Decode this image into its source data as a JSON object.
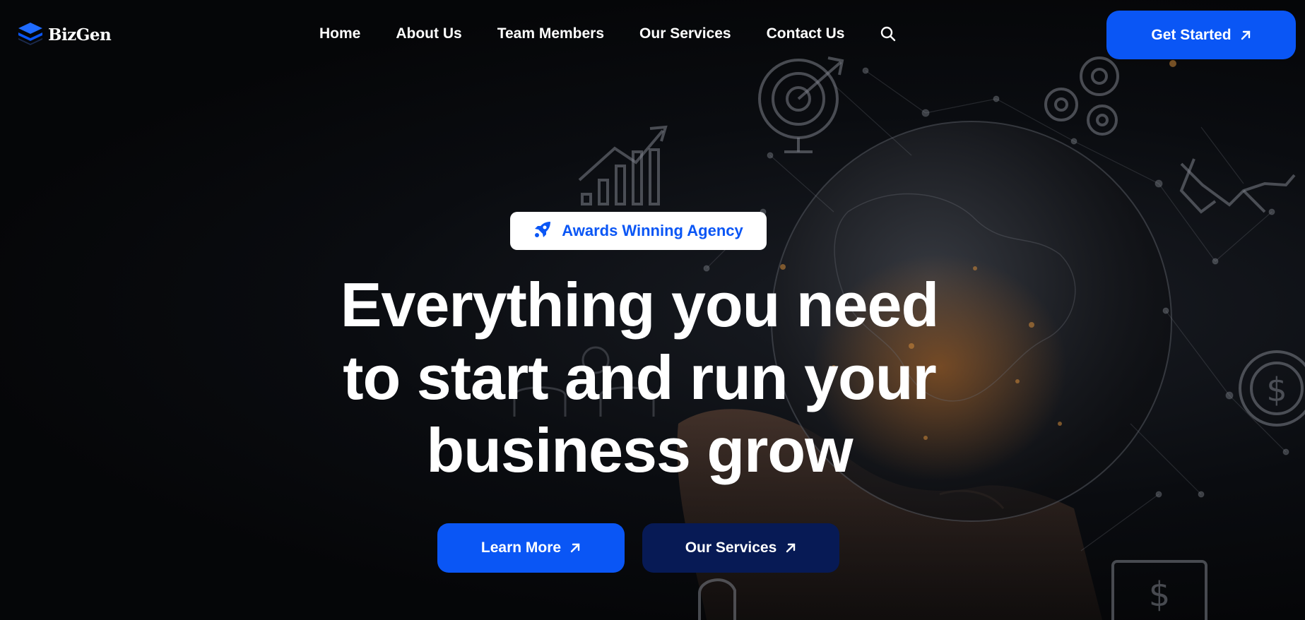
{
  "brand": {
    "name": "BizGen",
    "accent": "#0a56f5",
    "dark_accent": "#071a55"
  },
  "nav": {
    "items": [
      {
        "label": "Home"
      },
      {
        "label": "About Us"
      },
      {
        "label": "Team Members"
      },
      {
        "label": "Our Services"
      },
      {
        "label": "Contact Us"
      }
    ],
    "search_icon": "search-icon",
    "cta_label": "Get Started"
  },
  "hero": {
    "badge": {
      "icon": "rocket-icon",
      "label": "Awards Winning Agency"
    },
    "headline": {
      "line1": "Everything you need",
      "line2": "to start and run your",
      "line3": "business grow"
    },
    "buttons": {
      "primary_label": "Learn More",
      "secondary_label": "Our Services"
    }
  }
}
